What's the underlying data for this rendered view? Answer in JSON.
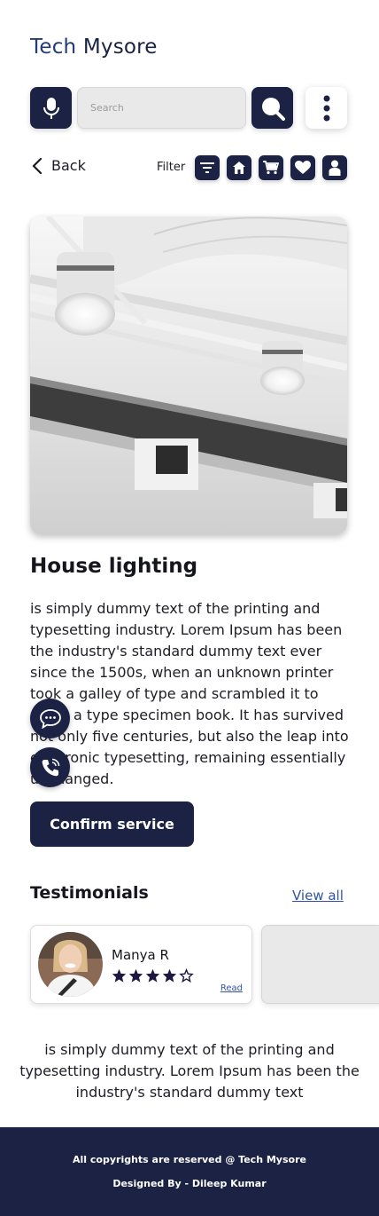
{
  "header": {
    "brand_part1": "Tech",
    "brand_part2": "Mysore"
  },
  "search": {
    "placeholder": "Search",
    "value": "",
    "mic_icon": "microphone-icon",
    "search_icon": "magnifier-icon",
    "menu_icon": "kebab-menu-icon"
  },
  "nav": {
    "back_label": "Back",
    "filter_label": "Filter",
    "filter_icons": [
      "filter-icon",
      "home-icon",
      "cart-icon",
      "heart-icon",
      "user-icon"
    ]
  },
  "service": {
    "image_alt": "ceiling lights photo",
    "title": "House lighting",
    "description": "is simply dummy text of the printing and typesetting industry. Lorem Ipsum has been the industry's standard dummy text ever since the 1500s, when an unknown printer took a galley of type and scrambled it to make a type specimen book. It has survived not only five centuries, but also the leap into electronic typesetting, remaining essentially unchanged.",
    "confirm_label": "Confirm service"
  },
  "floating": {
    "chat_icon": "chat-bubble-icon",
    "call_icon": "phone-call-icon"
  },
  "testimonials": {
    "title": "Testimonials",
    "view_all_label": "View all",
    "items": [
      {
        "name": "Manya R",
        "rating": 4,
        "max_rating": 5,
        "read_label": "Read"
      }
    ],
    "quote": "is simply dummy text of the printing and typesetting industry. Lorem Ipsum has been the industry's standard dummy text"
  },
  "footer": {
    "copyright": "All copyrights are reserved @ Tech Mysore",
    "designer": "Designed By - Dileep Kumar"
  },
  "colors": {
    "primary": "#1b2244",
    "brand_accent": "#233a78",
    "link": "#3152a8"
  }
}
